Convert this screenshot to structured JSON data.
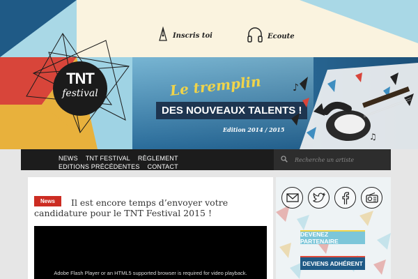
{
  "header": {
    "signup_label": "Inscris toi",
    "listen_label": "Ecoute",
    "logo_line1": "TNT",
    "logo_line2": "festival",
    "tagline_1": "Le tremplin",
    "tagline_2": "DES NOUVEAUX TALENTS !",
    "edition": "Edition 2014 / 2015"
  },
  "nav": {
    "items": [
      "NEWS",
      "TNT FESTIVAL",
      "RÈGLEMENT",
      "EDITIONS PRÉCÉDENTES",
      "CONTACT"
    ],
    "search_placeholder": "Recherche un artiste"
  },
  "article": {
    "badge": "News",
    "title": "Il est encore temps d’envoyer votre candidature pour le TNT Festival 2015 !",
    "video_message": "Adobe Flash Player or an HTML5 supported browser is required for video playback."
  },
  "sidebar": {
    "social_icons": [
      "mail-icon",
      "twitter-icon",
      "facebook-icon",
      "radio-icon"
    ],
    "partner_button": "DEVENEZ PARTENAIRE",
    "member_button": "DEVIENS ADHÉRENT"
  },
  "colors": {
    "red": "#cc2c22",
    "yellow": "#e8b13c",
    "blue": "#1f5a86",
    "light_blue": "#7cc6d9",
    "nav_bg": "#1c1c1c"
  }
}
